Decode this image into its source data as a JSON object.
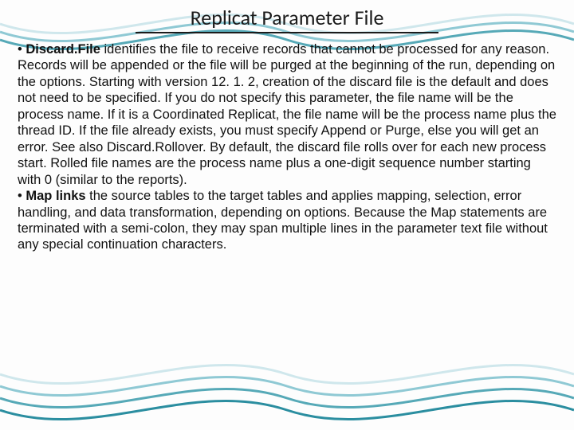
{
  "title": "Replicat Parameter File",
  "bullets": [
    {
      "lead": "Discard.File",
      "rest": " identifies the file to receive records that cannot be processed for any reason. Records will be appended or the file will be purged at the beginning of the run, depending on the options. Starting with version 12. 1. 2, creation of the discard file is the default and does not need to be specified. If you do not specify this parameter, the file name will be the process name. If it is a Coordinated Replicat, the file name will be the process name plus the thread ID. If the file already exists, you must specify Append or Purge, else you will get an error. See also Discard.Rollover. By default, the discard file rolls over for each new process start. Rolled file names are the process name plus a one-digit sequence number starting with 0 (similar to the reports)."
    },
    {
      "lead": "Map links",
      "rest": " the source tables to the target tables and applies mapping, selection, error handling, and data transformation, depending on options. Because the Map statements are terminated with a semi-colon, they may span multiple lines in the parameter text file without any special continuation characters."
    }
  ]
}
